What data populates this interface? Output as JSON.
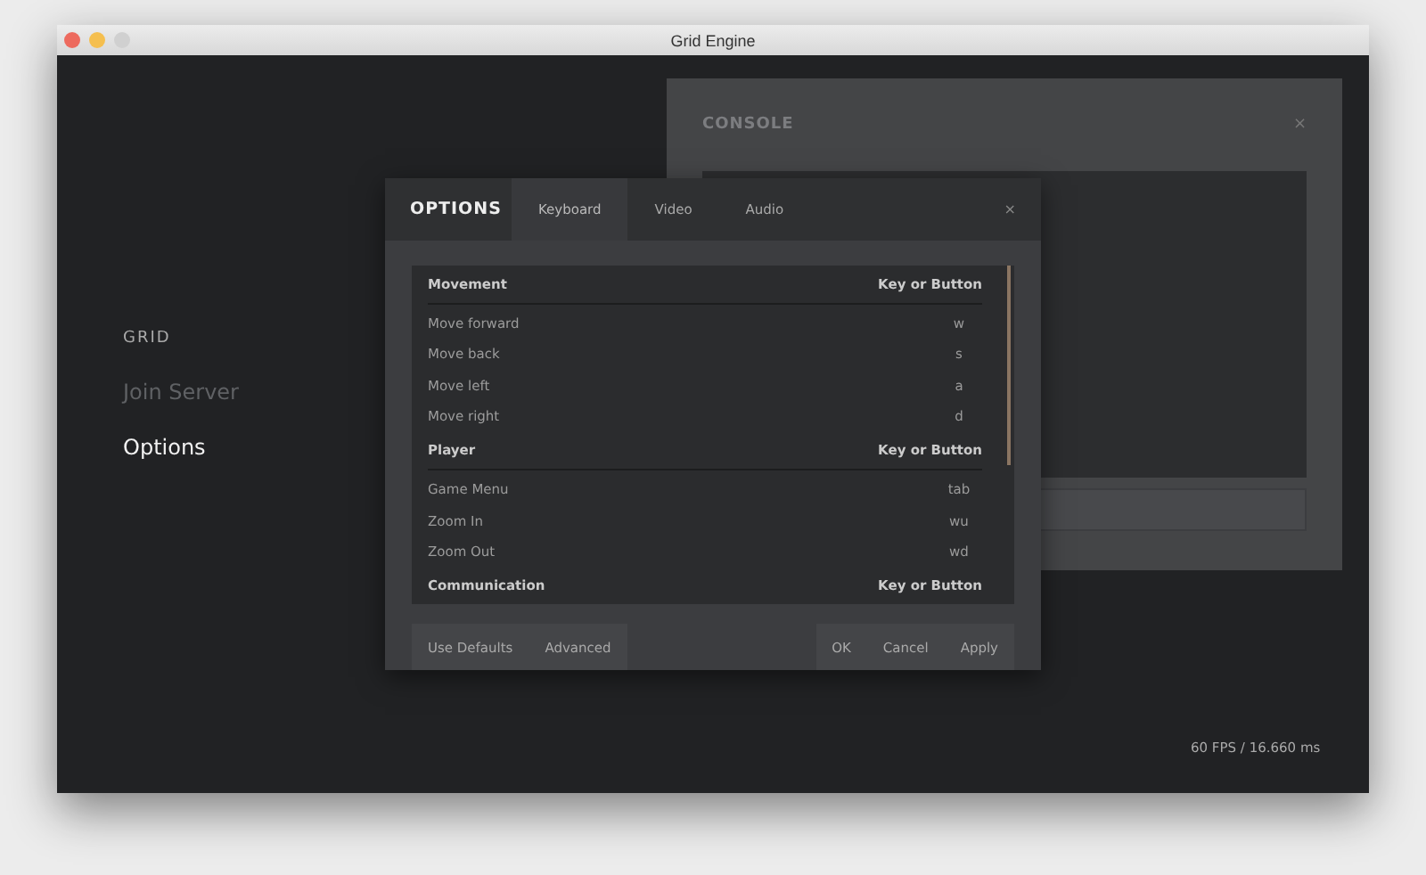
{
  "window": {
    "title": "Grid Engine",
    "controls": [
      {
        "color": "#ed6a5e"
      },
      {
        "color": "#f5bf4f"
      },
      {
        "color": "#d0d0d0"
      }
    ]
  },
  "menu": {
    "title": "GRID",
    "items": [
      {
        "label": "Join Server",
        "disabled": true,
        "selected": false
      },
      {
        "label": "Options",
        "disabled": false,
        "selected": true
      }
    ]
  },
  "console": {
    "title": "CONSOLE",
    "close": "×"
  },
  "options": {
    "title": "OPTIONS",
    "close": "×",
    "tabs": [
      {
        "label": "Keyboard",
        "selected": true
      },
      {
        "label": "Video",
        "selected": false
      },
      {
        "label": "Audio",
        "selected": false
      }
    ],
    "sections": [
      {
        "heading": "Movement",
        "column": "Key or Button",
        "rows": [
          {
            "action": "Move forward",
            "key": "w"
          },
          {
            "action": "Move back",
            "key": "s"
          },
          {
            "action": "Move left",
            "key": "a"
          },
          {
            "action": "Move right",
            "key": "d"
          }
        ]
      },
      {
        "heading": "Player",
        "column": "Key or Button",
        "rows": [
          {
            "action": "Game Menu",
            "key": "tab"
          },
          {
            "action": "Zoom In",
            "key": "wu"
          },
          {
            "action": "Zoom Out",
            "key": "wd"
          }
        ]
      },
      {
        "heading": "Communication",
        "column": "Key or Button"
      }
    ],
    "left_buttons": [
      "Use Defaults",
      "Advanced"
    ],
    "right_buttons": [
      "OK",
      "Cancel",
      "Apply"
    ]
  },
  "status": {
    "fps": "60 FPS / 16.660 ms"
  }
}
